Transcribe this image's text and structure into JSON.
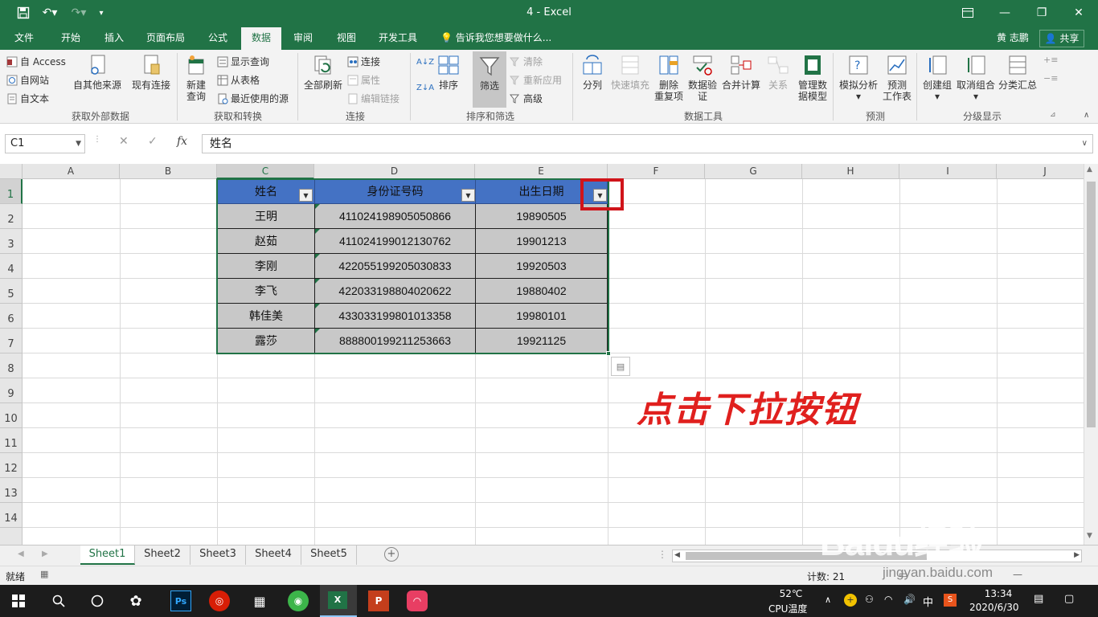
{
  "window": {
    "title": "4 - Excel"
  },
  "menu_tabs": [
    "文件",
    "开始",
    "插入",
    "页面布局",
    "公式",
    "数据",
    "审阅",
    "视图",
    "开发工具"
  ],
  "active_tab": "数据",
  "tell_me": "告诉我您想要做什么...",
  "user_name": "黄 志鹏",
  "share_label": "共享",
  "ribbon": {
    "get_external": {
      "access": "自 Access",
      "web": "自网站",
      "text": "自文本",
      "other": "自其他来源",
      "existing": "现有连接",
      "group": "获取外部数据"
    },
    "get_transform": {
      "new_query": "新建",
      "new_query2": "查询",
      "show_queries": "显示查询",
      "from_table": "从表格",
      "recent": "最近使用的源",
      "group": "获取和转换"
    },
    "connections": {
      "refresh_all": "全部刷新",
      "connections": "连接",
      "properties": "属性",
      "edit_links": "编辑链接",
      "group": "连接"
    },
    "sort_filter": {
      "sort": "排序",
      "filter": "筛选",
      "clear": "清除",
      "reapply": "重新应用",
      "advanced": "高级",
      "group": "排序和筛选"
    },
    "data_tools": {
      "text_to_columns": "分列",
      "flash_fill": "快速填充",
      "remove_dup1": "删除",
      "remove_dup2": "重复项",
      "validation1": "数据验",
      "validation2": "证",
      "consolidate": "合并计算",
      "relationships": "关系",
      "manage_model1": "管理数",
      "manage_model2": "据模型",
      "group": "数据工具"
    },
    "forecast": {
      "what_if": "模拟分析",
      "forecast1": "预测",
      "forecast2": "工作表",
      "group": "预测"
    },
    "outline": {
      "group_btn": "创建组",
      "ungroup": "取消组合",
      "subtotal": "分类汇总",
      "group": "分级显示"
    }
  },
  "formula_bar": {
    "name_box": "C1",
    "content": "姓名"
  },
  "columns": [
    "A",
    "B",
    "C",
    "D",
    "E",
    "F",
    "G",
    "H",
    "I",
    "J"
  ],
  "rows": [
    "1",
    "2",
    "3",
    "4",
    "5",
    "6",
    "7",
    "8",
    "9",
    "10",
    "11",
    "12",
    "13",
    "14"
  ],
  "table": {
    "headers": [
      "姓名",
      "身份证号码",
      "出生日期"
    ],
    "rows": [
      [
        "王明",
        "411024198905050866",
        "19890505"
      ],
      [
        "赵茹",
        "411024199012130762",
        "19901213"
      ],
      [
        "李刚",
        "422055199205030833",
        "19920503"
      ],
      [
        "李飞",
        "422033198804020622",
        "19880402"
      ],
      [
        "韩佳美",
        "433033199801013358",
        "19980101"
      ],
      [
        "露莎",
        "888800199211253663",
        "19921125"
      ]
    ]
  },
  "annotation": "点击下拉按钮",
  "sheets": [
    "Sheet1",
    "Sheet2",
    "Sheet3",
    "Sheet4",
    "Sheet5"
  ],
  "active_sheet": "Sheet1",
  "status": {
    "ready": "就绪",
    "count": "计数: 21"
  },
  "taskbar": {
    "temp": "52℃",
    "temp_label": "CPU温度",
    "time": "13:34",
    "date": "2020/6/30",
    "ime": "中"
  },
  "watermark": {
    "brand": "Baidu经验",
    "url": "jingyan.baidu.com"
  },
  "colors": {
    "excel_green": "#217346",
    "table_header": "#4472c4",
    "annotation_red": "#e0201e"
  }
}
